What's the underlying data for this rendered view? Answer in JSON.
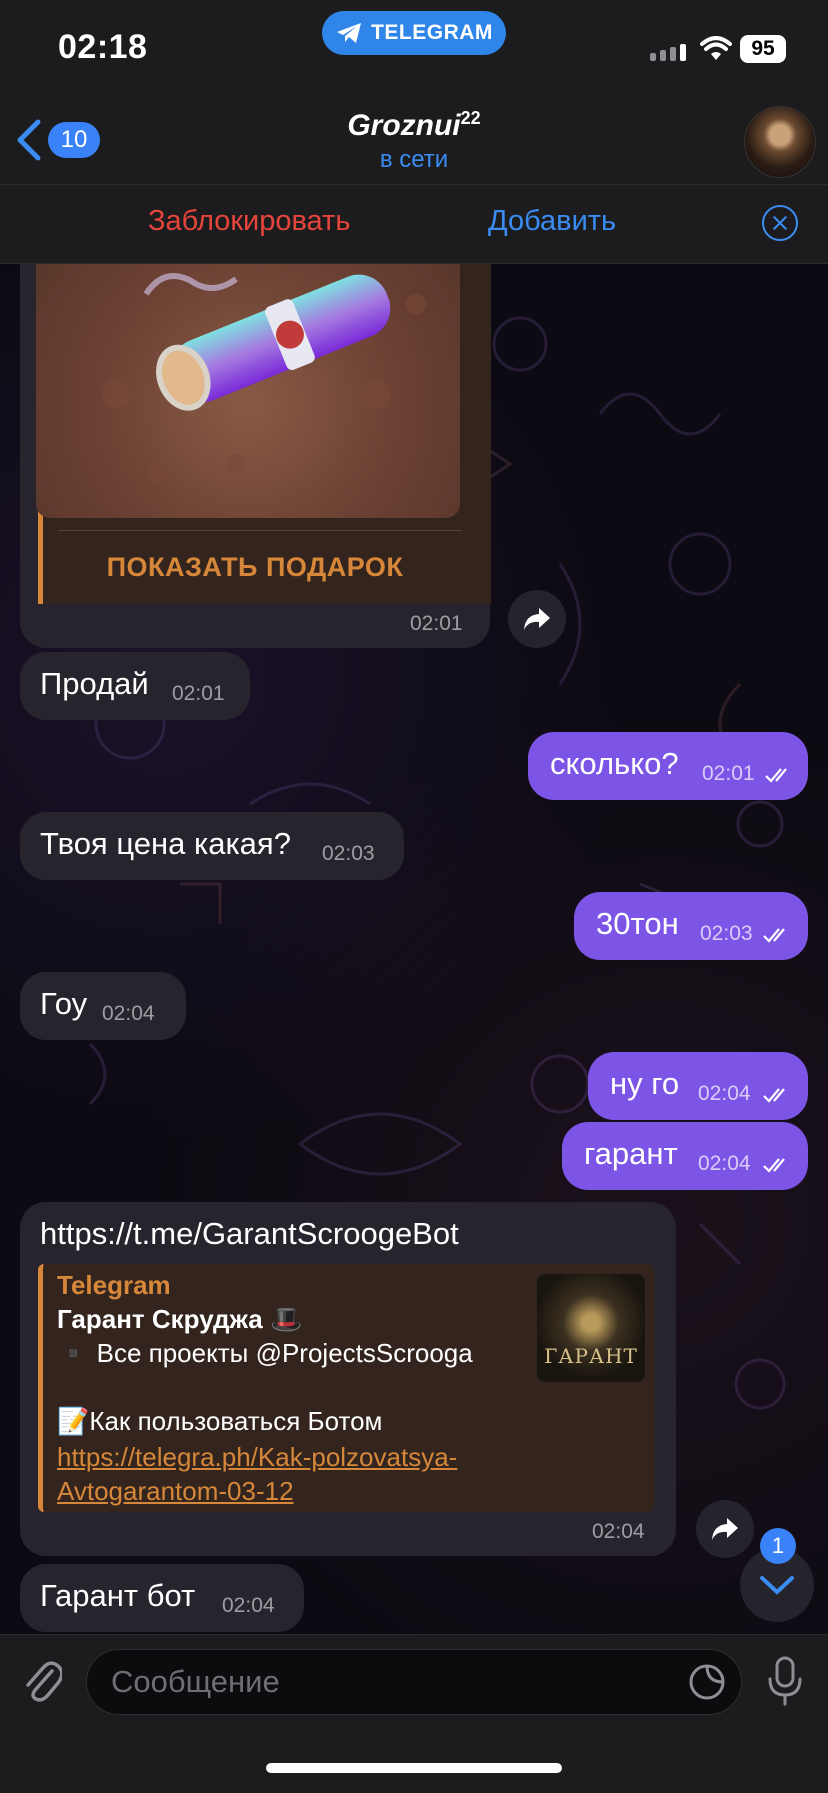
{
  "status_bar": {
    "time": "02:18",
    "app_pill": "TELEGRAM",
    "battery": "95"
  },
  "header": {
    "back_count": "10",
    "name": "Groznui",
    "name_sup": "22",
    "status": "в сети"
  },
  "action_bar": {
    "block_label": "Заблокировать",
    "add_label": "Добавить"
  },
  "gift": {
    "button": "ПОКАЗАТЬ ПОДАРОК",
    "time": "02:01"
  },
  "messages": [
    {
      "dir": "in",
      "text": "Продай",
      "time": "02:01"
    },
    {
      "dir": "out",
      "text": "сколько?",
      "time": "02:01"
    },
    {
      "dir": "in",
      "text": "Твоя цена какая?",
      "time": "02:03"
    },
    {
      "dir": "out",
      "text": "30тон",
      "time": "02:03"
    },
    {
      "dir": "in",
      "text": "Гоу",
      "time": "02:04"
    },
    {
      "dir": "out",
      "text": "ну го",
      "time": "02:04"
    },
    {
      "dir": "out",
      "text": "гарант",
      "time": "02:04"
    },
    {
      "dir": "in",
      "text": "Гарант бот",
      "time": "02:04"
    }
  ],
  "link_message": {
    "url": "https://t.me/GarantScroogeBot",
    "preview_site": "Telegram",
    "preview_title": "Гарант Скруджа 🎩",
    "preview_line1": "▪️ Все проекты @ProjectsScrooga",
    "preview_line2": "📝Как пользоваться Ботом",
    "preview_link": "https://telegra.ph/Kak-polzovatsya-Avtogarantom-03-12",
    "thumb_text": "ГАРАНТ",
    "time": "02:04"
  },
  "scroll_badge": "1",
  "input": {
    "placeholder": "Сообщение"
  },
  "colors": {
    "accent": "#3a8cf2",
    "outgoing": "#7d55e6",
    "incoming": "#27242d",
    "danger": "#e5453b",
    "gift_accent": "#d6873a"
  }
}
